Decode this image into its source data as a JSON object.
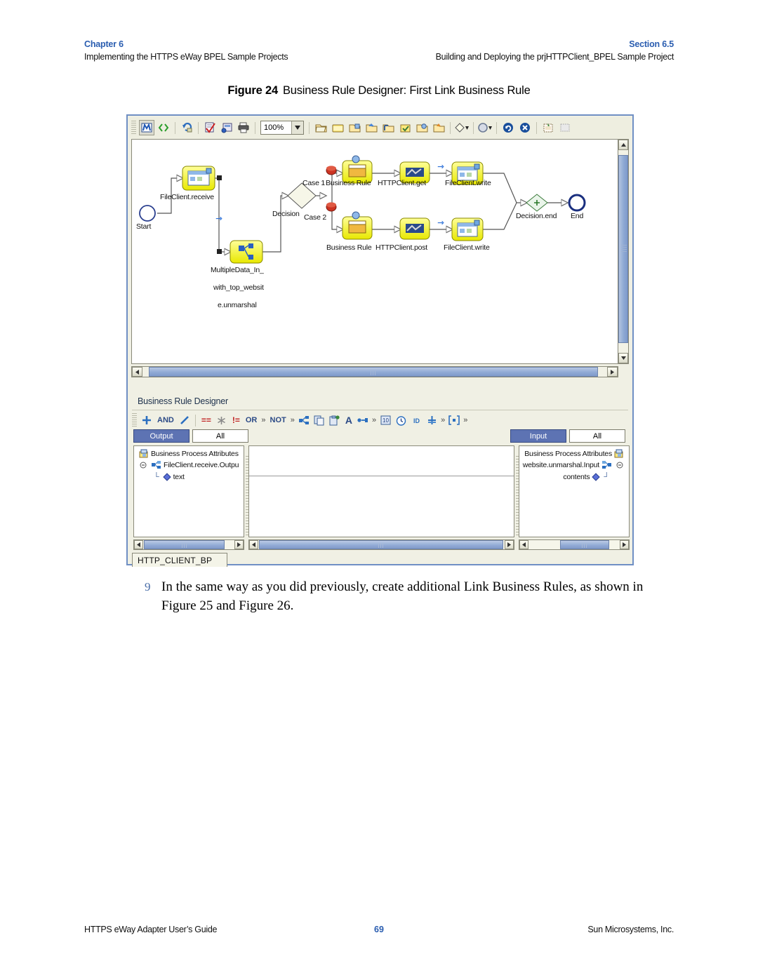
{
  "header": {
    "chapter_label": "Chapter 6",
    "chapter_subtitle": "Implementing the HTTPS eWay BPEL Sample Projects",
    "section_label": "Section 6.5",
    "section_subtitle": "Building and Deploying the prjHTTPClient_BPEL Sample Project"
  },
  "figure": {
    "number": "Figure 24",
    "title": "Business Rule Designer: First Link Business Rule"
  },
  "toolbar": {
    "zoom_value": "100%",
    "buttons": [
      {
        "name": "map-view-toggle",
        "icon": "map-icon",
        "pressed": true
      },
      {
        "name": "source-view-toggle",
        "icon": "code-brackets-icon",
        "pressed": false
      },
      {
        "name": "refresh-button",
        "icon": "refresh-icon",
        "pressed": false
      },
      {
        "name": "validate-button",
        "icon": "checklist-icon",
        "pressed": false
      },
      {
        "name": "properties-button",
        "icon": "properties-icon",
        "pressed": false
      },
      {
        "name": "print-button",
        "icon": "printer-icon",
        "pressed": false
      },
      {
        "name": "add-activity-button",
        "icon": "folder-open-icon",
        "pressed": false
      },
      {
        "name": "add-scope-button",
        "icon": "folder-plain-icon",
        "pressed": false
      },
      {
        "name": "add-invoke-button",
        "icon": "folder-invoke-icon",
        "pressed": false
      },
      {
        "name": "add-receive-button",
        "icon": "folder-receive-icon",
        "pressed": false
      },
      {
        "name": "add-reply-button",
        "icon": "folder-reply-icon",
        "pressed": false
      },
      {
        "name": "add-assign-button",
        "icon": "folder-assign-icon",
        "pressed": false
      },
      {
        "name": "add-wait-button",
        "icon": "folder-wait-icon",
        "pressed": false
      },
      {
        "name": "add-throw-button",
        "icon": "folder-throw-icon",
        "pressed": false
      },
      {
        "name": "decision-dropdown",
        "icon": "diamond-icon",
        "pressed": false
      },
      {
        "name": "circle-dropdown",
        "icon": "circle-icon",
        "pressed": false
      },
      {
        "name": "loop-button",
        "icon": "loop-arrow-icon",
        "pressed": false
      },
      {
        "name": "terminate-button",
        "icon": "cancel-x-icon",
        "pressed": false
      },
      {
        "name": "new-note-button",
        "icon": "note-add-icon",
        "pressed": false
      },
      {
        "name": "select-region-button",
        "icon": "selection-icon",
        "pressed": false
      }
    ]
  },
  "canvas": {
    "nodes": [
      {
        "name": "start-node",
        "label": "Start",
        "type": "start"
      },
      {
        "name": "fileclient-receive",
        "label": "FileClient.receive",
        "type": "activity"
      },
      {
        "name": "multipledata-unmarshal",
        "label": "MultipleData_In_",
        "label2": "with_top_websit",
        "label3": "e.unmarshal",
        "type": "activity"
      },
      {
        "name": "decision-node",
        "label": "Decision",
        "type": "decision"
      },
      {
        "name": "case-1-label",
        "label": "Case 1",
        "type": "case"
      },
      {
        "name": "case-2-label",
        "label": "Case 2",
        "type": "case"
      },
      {
        "name": "business-rule-1",
        "label": "Business Rule",
        "type": "rule"
      },
      {
        "name": "httpclient-get",
        "label": "HTTPClient.get",
        "type": "activity"
      },
      {
        "name": "fileclient-write-1",
        "label": "FileClient.write",
        "type": "activity"
      },
      {
        "name": "business-rule-2",
        "label": "Business Rule",
        "type": "rule"
      },
      {
        "name": "httpclient-post",
        "label": "HTTPClient.post",
        "type": "activity"
      },
      {
        "name": "fileclient-write-2",
        "label": "FileClient.write",
        "type": "activity"
      },
      {
        "name": "decision-end-node",
        "label": "Decision.end",
        "type": "decision-end"
      },
      {
        "name": "end-node",
        "label": "End",
        "type": "end"
      }
    ]
  },
  "business_rule_designer": {
    "title": "Business Rule Designer",
    "toolbar_items": [
      {
        "name": "add-operator-button",
        "glyph": "+",
        "kind": "plus"
      },
      {
        "name": "and-operator-button",
        "glyph": "AND",
        "kind": "text"
      },
      {
        "name": "link-tool-button",
        "glyph": "/",
        "kind": "slash"
      },
      {
        "name": "equal-operator-button",
        "glyph": "==",
        "kind": "red"
      },
      {
        "name": "not-equal-icon-button",
        "glyph": "*",
        "kind": "gray"
      },
      {
        "name": "not-equal-operator-button",
        "glyph": "!=",
        "kind": "red"
      },
      {
        "name": "or-operator-button",
        "glyph": "OR",
        "kind": "text"
      },
      {
        "name": "more-logic-button",
        "glyph": "»",
        "kind": "chev"
      },
      {
        "name": "not-operator-button",
        "glyph": "NOT",
        "kind": "text"
      },
      {
        "name": "more-boolean-button",
        "glyph": "»",
        "kind": "chev"
      },
      {
        "name": "nodes-button",
        "glyph": "",
        "kind": "icon-nodes"
      },
      {
        "name": "copy-button",
        "glyph": "",
        "kind": "icon-copy"
      },
      {
        "name": "paste-button",
        "glyph": "",
        "kind": "icon-paste"
      },
      {
        "name": "string-operator-button",
        "glyph": "A",
        "kind": "blueA"
      },
      {
        "name": "concat-button",
        "glyph": "",
        "kind": "icon-concat"
      },
      {
        "name": "more-string-button",
        "glyph": "»",
        "kind": "chev"
      },
      {
        "name": "number-operator-button",
        "glyph": "",
        "kind": "icon-number"
      },
      {
        "name": "datetime-button",
        "glyph": "",
        "kind": "icon-clock"
      },
      {
        "name": "id-button",
        "glyph": "",
        "kind": "icon-id"
      },
      {
        "name": "math-button",
        "glyph": "",
        "kind": "icon-math"
      },
      {
        "name": "more-number-button",
        "glyph": "»",
        "kind": "chev"
      },
      {
        "name": "array-button",
        "glyph": "",
        "kind": "icon-array"
      },
      {
        "name": "more-array-button",
        "glyph": "»",
        "kind": "chev"
      }
    ],
    "left_panel": {
      "tabs": [
        {
          "name": "tab-output",
          "label": "Output",
          "active": true
        },
        {
          "name": "tab-all-left",
          "label": "All",
          "active": false
        }
      ],
      "tree": [
        {
          "name": "tree-root-business-process-attributes",
          "label": "Business Process Attributes",
          "icon": "attributes-icon",
          "indent": 0
        },
        {
          "name": "tree-node-fileclient-receive-output",
          "label": "FileClient.receive.Outpu",
          "icon": "node-icon",
          "indent": 1
        },
        {
          "name": "tree-leaf-text",
          "label": "text",
          "icon": "diamond-icon",
          "indent": 2
        }
      ]
    },
    "right_panel": {
      "tabs": [
        {
          "name": "tab-input",
          "label": "Input",
          "active": true
        },
        {
          "name": "tab-all-right",
          "label": "All",
          "active": false
        }
      ],
      "tree": [
        {
          "name": "tree-root-business-process-attributes-input",
          "label": "Business Process Attributes",
          "icon": "attributes-icon",
          "indent": 0
        },
        {
          "name": "tree-node-website-unmarshal-input",
          "label": "website.unmarshal.Input",
          "icon": "node-icon",
          "indent": 1
        },
        {
          "name": "tree-leaf-contents",
          "label": "contents",
          "icon": "diamond-icon",
          "indent": 2
        }
      ]
    },
    "document_tab": "HTTP_CLIENT_BP"
  },
  "step": {
    "number": "9",
    "text": "In the same way as you did previously, create additional Link Business Rules, as shown in Figure 25 and Figure 26."
  },
  "footer": {
    "left": "HTTPS eWay Adapter User’s Guide",
    "page": "69",
    "right": "Sun Microsystems, Inc."
  },
  "colors": {
    "accent_blue": "#2a5db0",
    "window_border": "#6f8fc4",
    "tab_active": "#5d73b3",
    "node_fill": "#ffff66",
    "case_marker": "#cc3322"
  }
}
